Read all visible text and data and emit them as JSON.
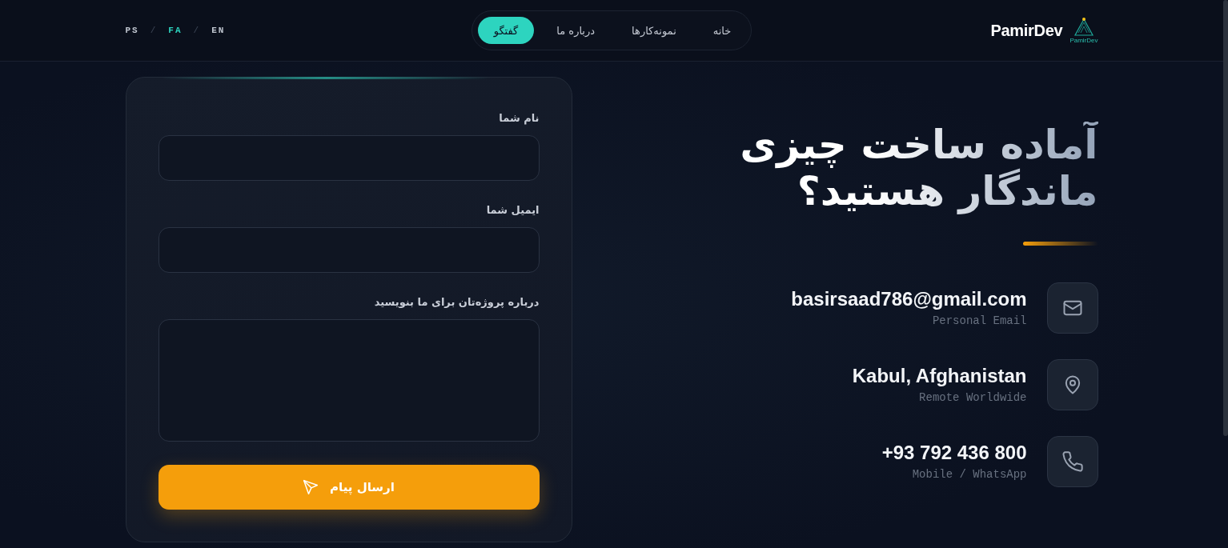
{
  "header": {
    "logo": {
      "text": "PamirDev",
      "mark_text": "PamirDev"
    },
    "nav": [
      {
        "label": "خانه",
        "selected": false
      },
      {
        "label": "نمونه‌کارها",
        "selected": false
      },
      {
        "label": "درباره ما",
        "selected": false
      },
      {
        "label": "گفتگو",
        "selected": true
      }
    ],
    "languages": [
      {
        "label": "EN",
        "selected": false
      },
      {
        "label": "FA",
        "selected": true
      },
      {
        "label": "PS",
        "selected": false
      }
    ],
    "separators": [
      "/",
      "/"
    ]
  },
  "hero": {
    "title": "آماده ساخت چیزی ماندگار هستید؟",
    "contacts": [
      {
        "kind": "email",
        "value": "basirsaad786@gmail.com",
        "label": "Personal Email"
      },
      {
        "kind": "location",
        "value": "Kabul, Afghanistan",
        "label": "Remote Worldwide"
      },
      {
        "kind": "phone",
        "value": "+93 792 436 800",
        "label": "Mobile / WhatsApp"
      }
    ]
  },
  "form": {
    "fields": [
      {
        "kind": "input",
        "label": "نام شما"
      },
      {
        "kind": "input",
        "label": "ایمیل شما"
      },
      {
        "kind": "textarea",
        "label": "درباره پروژه‌تان برای ما بنویسید"
      }
    ],
    "submit": "ارسال پیام"
  }
}
